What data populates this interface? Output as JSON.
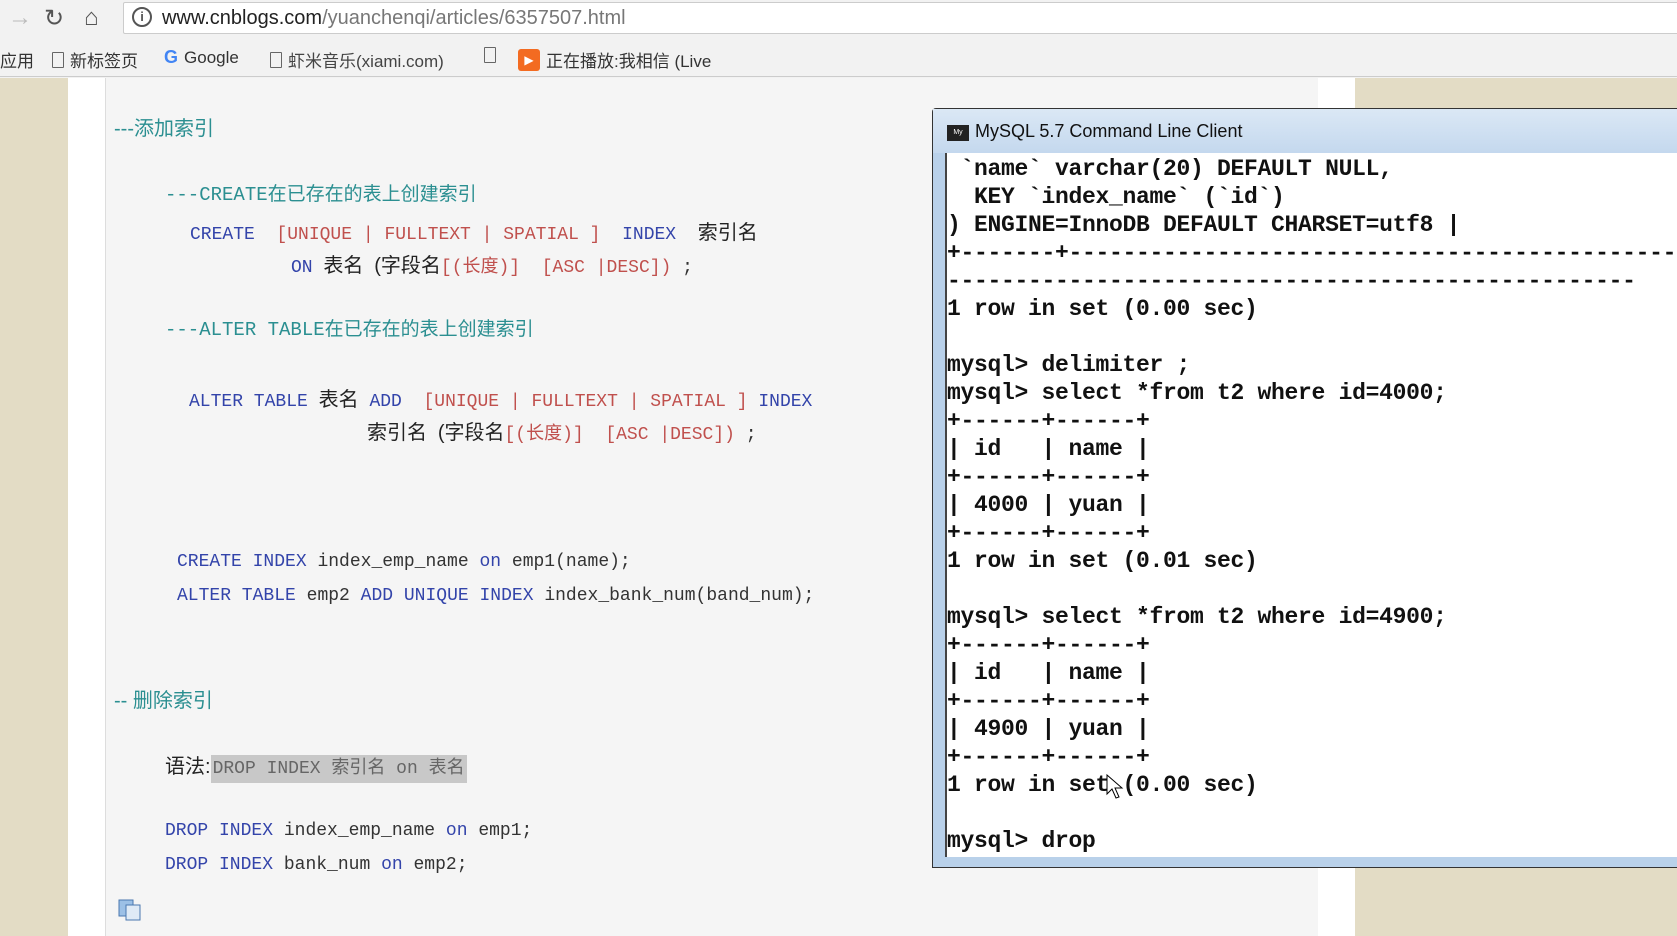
{
  "browser": {
    "url_host": "www.cnblogs.com",
    "url_path": "/yuanchenqi/articles/6357507.html",
    "bookmarks": [
      {
        "label": "应用"
      },
      {
        "label": "新标签页",
        "icon": "file-icon"
      },
      {
        "label": "Google",
        "icon": "google-icon"
      },
      {
        "label": "虾米音乐(xiami.com)",
        "icon": "file-icon"
      },
      {
        "label": "",
        "icon": "file-icon"
      },
      {
        "label": "正在播放:我相信 (Live",
        "icon": "play-icon"
      }
    ]
  },
  "article": {
    "h_add": "---添加索引",
    "h_create": "---CREATE在已存在的表上创建索引",
    "create1": {
      "kw": "CREATE",
      "opts": "[UNIQUE | FULLTEXT | SPATIAL ]",
      "kw2": "INDEX",
      "name": "索引名"
    },
    "create2": {
      "kw": "ON",
      "tbl": "表名",
      "f": "(字段名",
      "len": "[(长度)]",
      "asc": "[ASC |DESC])",
      "end": ";"
    },
    "h_alter": "---ALTER TABLE在已存在的表上创建索引",
    "alter1": {
      "kw": "ALTER TABLE",
      "tbl": "表名",
      "add": "ADD",
      "opts": "[UNIQUE | FULLTEXT | SPATIAL ]",
      "kw2": "INDEX"
    },
    "alter2": {
      "name": "索引名",
      "f": "(字段名",
      "len": "[(长度)]",
      "asc": "[ASC |DESC])",
      "end": ";"
    },
    "ex1": {
      "a": "CREATE INDEX",
      "b": "index_emp_name",
      "c": "on",
      "d": "emp1(name);"
    },
    "ex2": {
      "a": "ALTER TABLE",
      "b": "emp2",
      "c": "ADD UNIQUE INDEX",
      "d": "index_bank_num(band_num);"
    },
    "h_drop": "-- 删除索引",
    "syntax_label": "语法:",
    "syntax": "DROP INDEX 索引名 on 表名",
    "drop1": {
      "a": "DROP INDEX",
      "b": "index_emp_name",
      "c": "on",
      "d": "emp1;"
    },
    "drop2": {
      "a": "DROP INDEX",
      "b": "bank_num",
      "c": "on",
      "d": "emp2;"
    }
  },
  "terminal": {
    "title": "MySQL 5.7 Command Line Client",
    "lines": [
      " `name` varchar(20) DEFAULT NULL,",
      "  KEY `index_name` (`id`)",
      ") ENGINE=InnoDB DEFAULT CHARSET=utf8 |",
      "+-------+---------------------------------------------",
      "---------------------------------------------------",
      "1 row in set (0.00 sec)",
      "",
      "mysql> delimiter ;",
      "mysql> select *from t2 where id=4000;",
      "+------+------+",
      "| id   | name |",
      "+------+------+",
      "| 4000 | yuan |",
      "+------+------+",
      "1 row in set (0.01 sec)",
      "",
      "mysql> select *from t2 where id=4900;",
      "+------+------+",
      "| id   | name |",
      "+------+------+",
      "| 4900 | yuan |",
      "+------+------+",
      "1 row in set (0.00 sec)",
      "",
      "mysql> drop"
    ]
  },
  "colors": {
    "comment": "#2b8f91",
    "keyword": "#3344aa",
    "option": "#c0504d"
  }
}
